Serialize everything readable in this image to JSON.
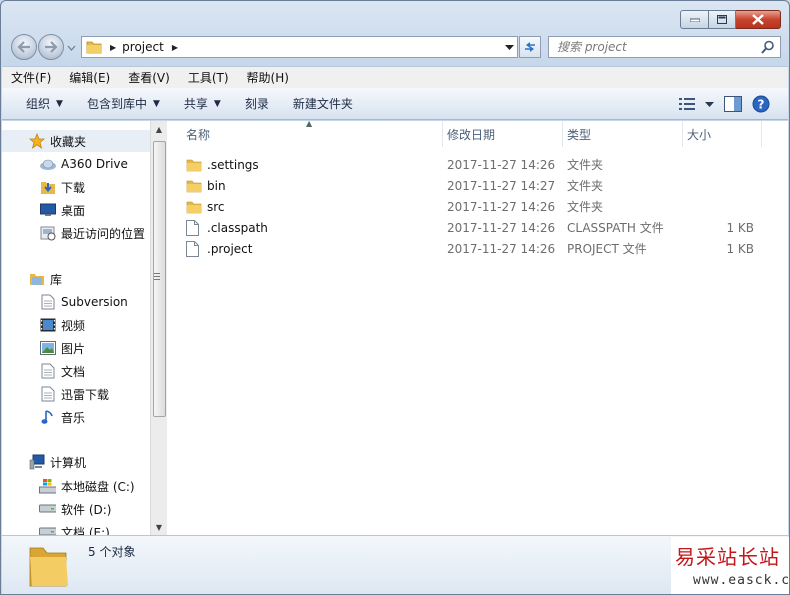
{
  "window": {
    "caption_buttons": [
      "minimize",
      "maximize",
      "close"
    ]
  },
  "address": {
    "crumbs": [
      "project"
    ],
    "search_placeholder": "搜索 project"
  },
  "menubar": {
    "items": [
      {
        "label": "文件(F)"
      },
      {
        "label": "编辑(E)"
      },
      {
        "label": "查看(V)"
      },
      {
        "label": "工具(T)"
      },
      {
        "label": "帮助(H)"
      }
    ]
  },
  "commandbar": {
    "organize": "组织",
    "include_library": "包含到库中",
    "share": "共享",
    "burn": "刻录",
    "new_folder": "新建文件夹"
  },
  "navpane": {
    "favorites": {
      "label": "收藏夹",
      "items": [
        {
          "label": "A360 Drive",
          "icon": "cloud-drive-icon"
        },
        {
          "label": "下载",
          "icon": "downloads-icon"
        },
        {
          "label": "桌面",
          "icon": "desktop-icon"
        },
        {
          "label": "最近访问的位置",
          "icon": "recent-places-icon"
        }
      ]
    },
    "libraries": {
      "label": "库",
      "items": [
        {
          "label": "Subversion",
          "icon": "document-icon"
        },
        {
          "label": "视频",
          "icon": "video-icon"
        },
        {
          "label": "图片",
          "icon": "picture-icon"
        },
        {
          "label": "文档",
          "icon": "document-icon"
        },
        {
          "label": "迅雷下载",
          "icon": "document-icon"
        },
        {
          "label": "音乐",
          "icon": "music-icon"
        }
      ]
    },
    "computer": {
      "label": "计算机",
      "items": [
        {
          "label": "本地磁盘 (C:)",
          "icon": "system-drive-icon"
        },
        {
          "label": "软件 (D:)",
          "icon": "drive-icon"
        },
        {
          "label": "文档 (E:)",
          "icon": "drive-icon"
        }
      ]
    }
  },
  "columns": {
    "name": "名称",
    "date": "修改日期",
    "type": "类型",
    "size": "大小"
  },
  "files": [
    {
      "name": ".settings",
      "date": "2017-11-27 14:26",
      "type": "文件夹",
      "size": "",
      "icon": "folder-icon"
    },
    {
      "name": "bin",
      "date": "2017-11-27 14:27",
      "type": "文件夹",
      "size": "",
      "icon": "folder-icon"
    },
    {
      "name": "src",
      "date": "2017-11-27 14:26",
      "type": "文件夹",
      "size": "",
      "icon": "folder-icon"
    },
    {
      "name": ".classpath",
      "date": "2017-11-27 14:26",
      "type": "CLASSPATH 文件",
      "size": "1 KB",
      "icon": "file-icon"
    },
    {
      "name": ".project",
      "date": "2017-11-27 14:26",
      "type": "PROJECT 文件",
      "size": "1 KB",
      "icon": "file-icon"
    }
  ],
  "status": {
    "count": "5 个对象"
  },
  "watermark": {
    "title": "易采站长站",
    "url": "www.easck.com"
  }
}
